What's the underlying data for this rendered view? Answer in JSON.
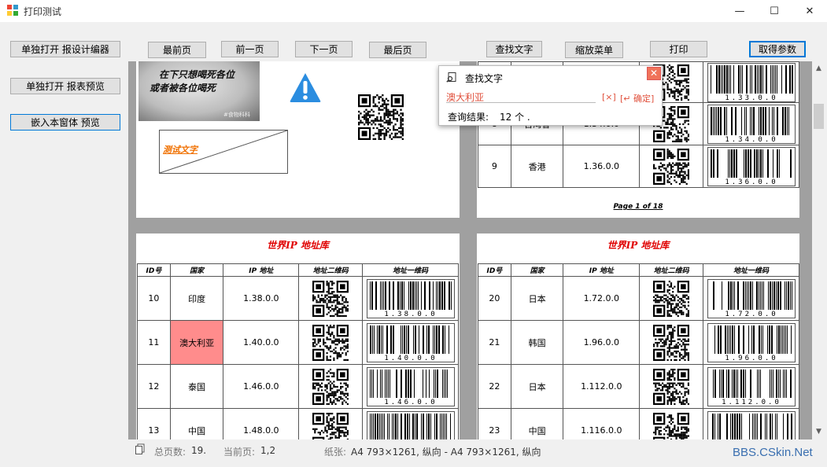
{
  "window": {
    "title": "打印测试",
    "minimize": "—",
    "maximize": "☐",
    "close": "✕"
  },
  "left_buttons": {
    "open_designer": "单独打开 报设计编器",
    "open_preview": "单独打开 报表预览",
    "embed_preview": "嵌入本窗体 预览"
  },
  "toolbar": {
    "first_page": "最前页",
    "prev_page": "前一页",
    "next_page": "下一页",
    "last_page": "最后页",
    "find_text": "查找文字",
    "zoom_menu": "缩放菜单",
    "print": "打印",
    "get_params": "取得参数"
  },
  "find_dialog": {
    "title": "查找文字",
    "query": "澳大利亚",
    "clear_label": "[×]",
    "confirm_label": "[↵ 确定]",
    "result_label": "查询结果:",
    "result_value": "12 个 ."
  },
  "page1_top": {
    "photo_caption_line1": "在下只想喝死各位",
    "photo_caption_line2": "或者被各位喝死",
    "photo_watermark": "#食物科科",
    "test_text": "测试文字"
  },
  "page2_top": {
    "rows": [
      {
        "id": "8",
        "country": "台湾省",
        "ip": "1.34.0.0",
        "barcode": "1.34.0.0"
      },
      {
        "id": "9",
        "country": "香港",
        "ip": "1.36.0.0",
        "barcode": "1.36.0.0"
      }
    ],
    "barcode_top": "1.33.0.0",
    "footer": "Page 1 of 18"
  },
  "page_title": "世界IP 地址库",
  "columns": [
    "ID号",
    "国家",
    "IP 地址",
    "地址二维码",
    "地址一维码"
  ],
  "page3": {
    "rows": [
      {
        "id": "10",
        "country": "印度",
        "ip": "1.38.0.0",
        "barcode": "1.38.0.0"
      },
      {
        "id": "11",
        "country": "澳大利亚",
        "ip": "1.40.0.0",
        "barcode": "1.40.0.0"
      },
      {
        "id": "12",
        "country": "泰国",
        "ip": "1.46.0.0",
        "barcode": "1.46.0.0"
      },
      {
        "id": "13",
        "country": "中国",
        "ip": "1.48.0.0",
        "barcode": ""
      }
    ]
  },
  "page4": {
    "rows": [
      {
        "id": "20",
        "country": "日本",
        "ip": "1.72.0.0",
        "barcode": "1.72.0.0"
      },
      {
        "id": "21",
        "country": "韩国",
        "ip": "1.96.0.0",
        "barcode": "1.96.0.0"
      },
      {
        "id": "22",
        "country": "日本",
        "ip": "1.112.0.0",
        "barcode": "1.112.0.0"
      },
      {
        "id": "23",
        "country": "中国",
        "ip": "1.116.0.0",
        "barcode": ""
      }
    ]
  },
  "highlight_color": "#ff8c8c",
  "status": {
    "total_pages_label": "总页数:",
    "total_pages_value": "19.",
    "current_page_label": "当前页:",
    "current_page_value": "1,2",
    "paper_label": "纸张:",
    "paper_value": "A4  793×1261, 纵向  -  A4  793×1261, 纵向",
    "watermark": "BBS.CSkin.Net"
  }
}
